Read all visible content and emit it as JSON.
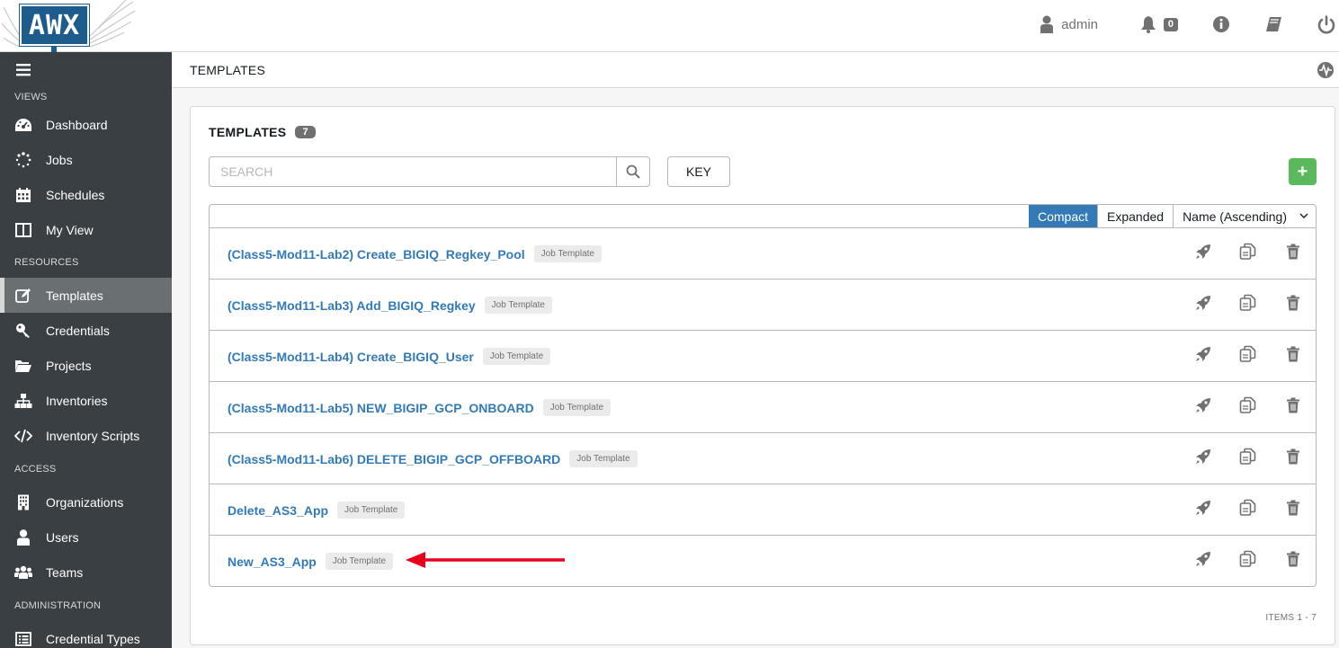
{
  "header": {
    "logo_text": "AWX",
    "user": "admin",
    "notifications": "0",
    "colors": {
      "brand": "#1d5b8c",
      "icon": "#707070"
    }
  },
  "sidebar": {
    "sections": [
      {
        "label": "VIEWS"
      },
      {
        "label": "RESOURCES"
      },
      {
        "label": "ACCESS"
      },
      {
        "label": "ADMINISTRATION"
      }
    ],
    "items": [
      {
        "label": "Dashboard",
        "icon": "dashboard-icon"
      },
      {
        "label": "Jobs",
        "icon": "spinner-icon"
      },
      {
        "label": "Schedules",
        "icon": "calendar-icon"
      },
      {
        "label": "My View",
        "icon": "columns-icon"
      },
      {
        "label": "Templates",
        "icon": "pencil-square-icon",
        "active": true
      },
      {
        "label": "Credentials",
        "icon": "key-icon"
      },
      {
        "label": "Projects",
        "icon": "folder-open-icon"
      },
      {
        "label": "Inventories",
        "icon": "sitemap-icon"
      },
      {
        "label": "Inventory Scripts",
        "icon": "code-icon"
      },
      {
        "label": "Organizations",
        "icon": "building-icon"
      },
      {
        "label": "Users",
        "icon": "user-icon"
      },
      {
        "label": "Teams",
        "icon": "users-icon"
      },
      {
        "label": "Credential Types",
        "icon": "list-alt-icon"
      }
    ]
  },
  "breadcrumb": {
    "title": "TEMPLATES"
  },
  "panel": {
    "title": "TEMPLATES",
    "count": "7",
    "search_placeholder": "SEARCH",
    "key_label": "KEY",
    "add_label": "+",
    "view_toggle": {
      "compact": "Compact",
      "expanded": "Expanded",
      "selected": "Compact"
    },
    "sort_label": "Name (Ascending)",
    "rows": [
      {
        "name": "(Class5-Mod11-Lab2) Create_BIGIQ_Regkey_Pool",
        "type": "Job Template"
      },
      {
        "name": "(Class5-Mod11-Lab3) Add_BIGIQ_Regkey",
        "type": "Job Template"
      },
      {
        "name": "(Class5-Mod11-Lab4) Create_BIGIQ_User",
        "type": "Job Template"
      },
      {
        "name": "(Class5-Mod11-Lab5) NEW_BIGIP_GCP_ONBOARD",
        "type": "Job Template"
      },
      {
        "name": "(Class5-Mod11-Lab6) DELETE_BIGIP_GCP_OFFBOARD",
        "type": "Job Template"
      },
      {
        "name": "Delete_AS3_App",
        "type": "Job Template"
      },
      {
        "name": "New_AS3_App",
        "type": "Job Template"
      }
    ],
    "items_count": "ITEMS  1 - 7",
    "colors": {
      "link": "#337ab7",
      "add": "#5cb85c",
      "annotation_arrow": "#e8001c"
    }
  }
}
